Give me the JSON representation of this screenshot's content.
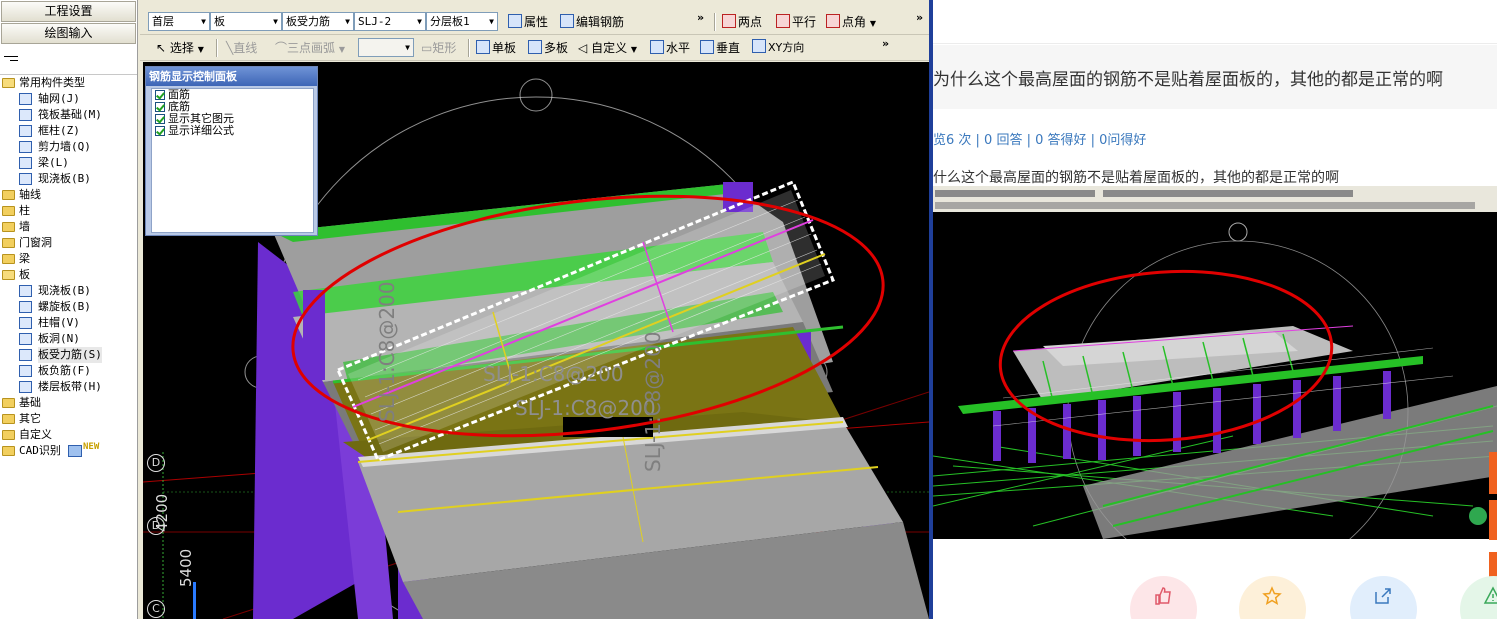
{
  "cad": {
    "sidebar": {
      "project_settings": "工程设置",
      "drawing_input": "绘图输入",
      "tree": [
        {
          "label": "常用构件类型",
          "type": "folder",
          "level": 0
        },
        {
          "label": "轴网(J)",
          "type": "leaf",
          "level": 1
        },
        {
          "label": "筏板基础(M)",
          "type": "leaf",
          "level": 1
        },
        {
          "label": "框柱(Z)",
          "type": "leaf",
          "level": 1
        },
        {
          "label": "剪力墙(Q)",
          "type": "leaf",
          "level": 1
        },
        {
          "label": "梁(L)",
          "type": "leaf",
          "level": 1
        },
        {
          "label": "现浇板(B)",
          "type": "leaf",
          "level": 1
        },
        {
          "label": "轴线",
          "type": "folder",
          "level": 0
        },
        {
          "label": "柱",
          "type": "folder",
          "level": 0
        },
        {
          "label": "墙",
          "type": "folder",
          "level": 0
        },
        {
          "label": "门窗洞",
          "type": "folder",
          "level": 0
        },
        {
          "label": "梁",
          "type": "folder",
          "level": 0
        },
        {
          "label": "板",
          "type": "folder",
          "level": 0
        },
        {
          "label": "现浇板(B)",
          "type": "leaf",
          "level": 1
        },
        {
          "label": "螺旋板(B)",
          "type": "leaf",
          "level": 1
        },
        {
          "label": "柱帽(V)",
          "type": "leaf",
          "level": 1
        },
        {
          "label": "板洞(N)",
          "type": "leaf",
          "level": 1
        },
        {
          "label": "板受力筋(S)",
          "type": "leaf",
          "level": 1,
          "selected": true
        },
        {
          "label": "板负筋(F)",
          "type": "leaf",
          "level": 1
        },
        {
          "label": "楼层板带(H)",
          "type": "leaf",
          "level": 1
        },
        {
          "label": "基础",
          "type": "folder",
          "level": 0
        },
        {
          "label": "其它",
          "type": "folder",
          "level": 0
        },
        {
          "label": "自定义",
          "type": "folder",
          "level": 0
        },
        {
          "label": "CAD识别",
          "type": "folder",
          "level": 0,
          "badge": "NEW"
        }
      ]
    },
    "toolbar1": {
      "floor": "首层",
      "component_type": "板",
      "sub_type": "板受力筋",
      "name": "SLJ-2",
      "layer": "分层板1",
      "properties": "属性",
      "edit_rebar": "编辑钢筋",
      "two_points": "两点",
      "parallel": "平行",
      "point_angle": "点角"
    },
    "toolbar2": {
      "select": "选择",
      "line": "直线",
      "arc": "三点画弧",
      "rect": "矩形",
      "single_slab": "单板",
      "multi_slab": "多板",
      "custom": "自定义",
      "horizontal": "水平",
      "vertical": "垂直",
      "xy": "XY方向"
    },
    "control_panel": {
      "title": "钢筋显示控制面板",
      "options": [
        "面筋",
        "底筋",
        "显示其它图元",
        "显示详细公式"
      ]
    },
    "viewport": {
      "labels": [
        "SLJ-1:C8@200",
        "SLJ-1:C8@200",
        "SLJ-1:C8@200",
        "SLJ-1:C8@200"
      ],
      "axis_marks": [
        "D",
        "D",
        "C"
      ],
      "dims": [
        "4200",
        "5400"
      ]
    }
  },
  "qa": {
    "title": "为什么这个最高屋面的钢筋不是贴着屋面板的，其他的都是正常的啊",
    "stats": "览6 次 | 0 回答 | 0 答得好 | 0问得好",
    "body": "什么这个最高屋面的钢筋不是贴着屋面板的，其他的都是正常的啊",
    "colors": {
      "link": "#3a78bd",
      "accent": "#f0621f"
    }
  }
}
